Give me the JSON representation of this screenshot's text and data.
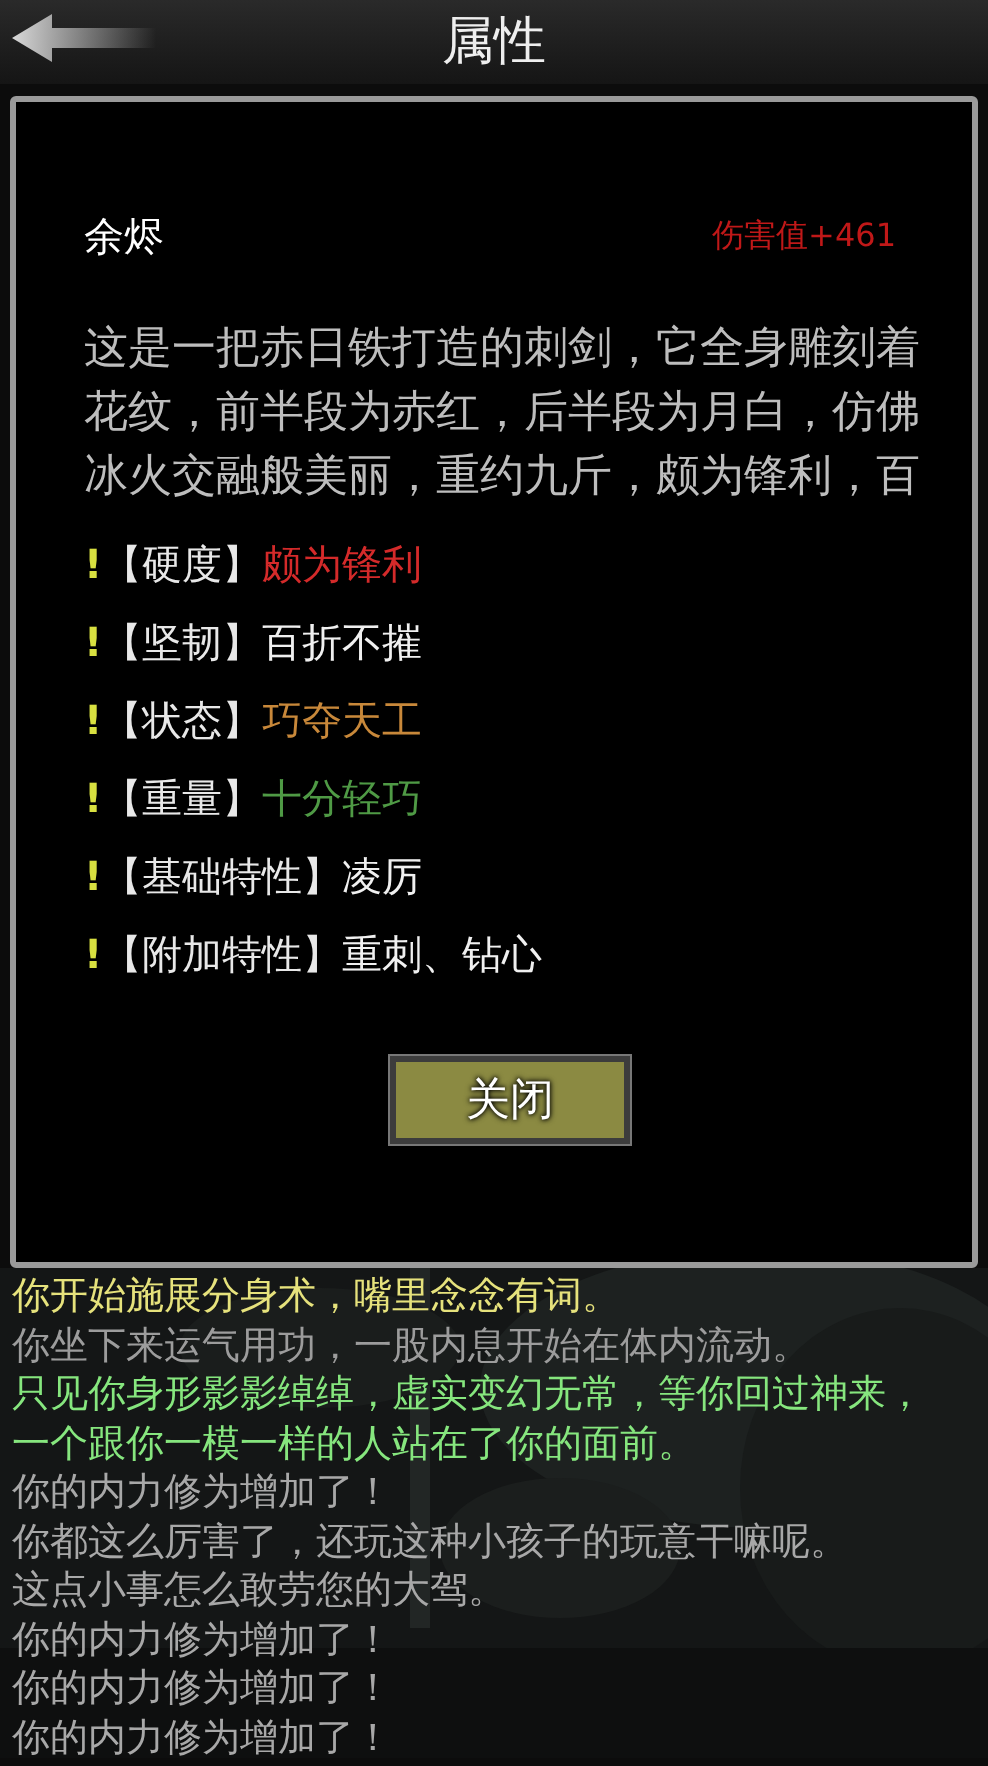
{
  "header": {
    "title": "属性"
  },
  "item": {
    "name": "余烬",
    "damage": "伤害值+461",
    "description": "这是一把赤日铁打造的刺剑，它全身雕刻着花纹，前半段为赤红，后半段为月白，仿佛冰火交融般美丽，重约九斤，颇为锋利，百"
  },
  "attributes": [
    {
      "marker": "!",
      "label": "【硬度】",
      "value": "颇为锋利",
      "color": "#d42a2a"
    },
    {
      "marker": "!",
      "label": "【坚韧】",
      "value": "百折不摧",
      "color": "#f0f0f0"
    },
    {
      "marker": "!",
      "label": "【状态】",
      "value": "巧夺天工",
      "color": "#c8883a"
    },
    {
      "marker": "!",
      "label": "【重量】",
      "value": "十分轻巧",
      "color": "#4f9a45"
    },
    {
      "marker": "!",
      "label": "【基础特性】",
      "value": "凌厉",
      "color": "#f0f0f0"
    },
    {
      "marker": "!",
      "label": "【附加特性】",
      "value": "重刺、钻心",
      "color": "#f0f0f0"
    }
  ],
  "close_button": "关闭",
  "log": [
    {
      "text": "你开始施展分身术，嘴里念念有词。",
      "color": "#e6e27c"
    },
    {
      "text": "你坐下来运气用功，一股内息开始在体内流动。",
      "color": "#9c9c9c"
    },
    {
      "text": "只见你身形影影绰绰，虚实变幻无常，等你回过神来，一个跟你一模一样的人站在了你的面前。",
      "color": "#86e67e"
    },
    {
      "text": "你的内力修为增加了！",
      "color": "#a8a8a8"
    },
    {
      "text": "你都这么厉害了，还玩这种小孩子的玩意干嘛呢。",
      "color": "#a8a8a8"
    },
    {
      "text": "这点小事怎么敢劳您的大驾。",
      "color": "#a8a8a8"
    },
    {
      "text": "你的内力修为增加了！",
      "color": "#a8a8a8"
    },
    {
      "text": "你的内力修为增加了！",
      "color": "#a8a8a8"
    },
    {
      "text": "你的内力修为增加了！",
      "color": "#a8a8a8"
    }
  ]
}
